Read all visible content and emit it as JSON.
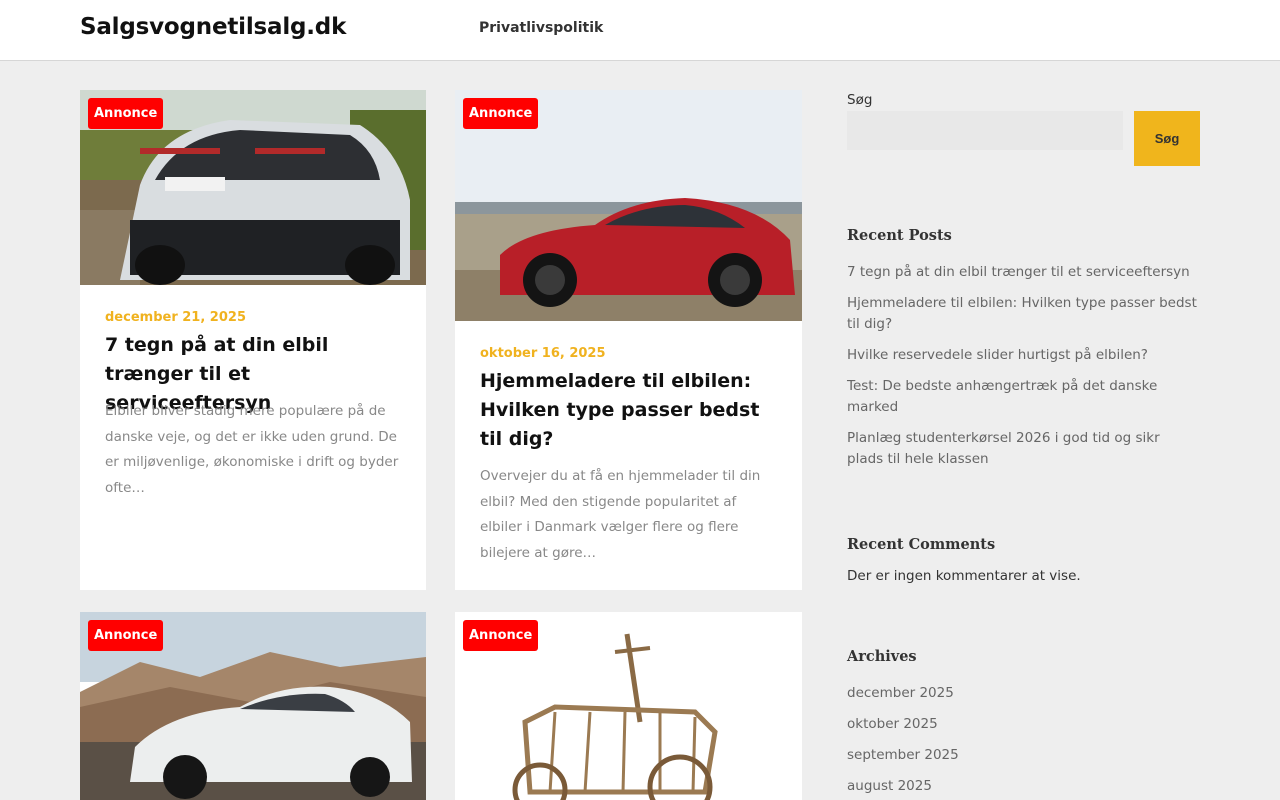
{
  "header": {
    "site_title": "Salgsvognetilsalg.dk",
    "nav": [
      "Privatlivspolitik"
    ]
  },
  "posts": [
    {
      "badge": "Annonce",
      "date": "december 21, 2025",
      "title": "7 tegn på at din elbil trænger til et serviceeftersyn",
      "excerpt": "Elbiler bliver stadig mere populære på de danske veje, og det er ikke uden grund. De er miljøvenlige, økonomiske i drift og byder ofte…"
    },
    {
      "badge": "Annonce",
      "date": "oktober 16, 2025",
      "title": "Hjemmeladere til elbilen: Hvilken type passer bedst til dig?",
      "excerpt": "Overvejer du at få en hjemmelader til din elbil? Med den stigende popularitet af elbiler i Danmark vælger flere og flere bilejere at gøre…"
    },
    {
      "badge": "Annonce"
    },
    {
      "badge": "Annonce"
    }
  ],
  "sidebar": {
    "search": {
      "label": "Søg",
      "button": "Søg",
      "value": ""
    },
    "recent_posts": {
      "title": "Recent Posts",
      "items": [
        "7 tegn på at din elbil trænger til et serviceeftersyn",
        "Hjemmeladere til elbilen: Hvilken type passer bedst til dig?",
        "Hvilke reservedele slider hurtigst på elbilen?",
        "Test: De bedste anhængertræk på det danske marked",
        "Planlæg studenterkørsel 2026 i god tid og sikr plads til hele klassen"
      ]
    },
    "recent_comments": {
      "title": "Recent Comments",
      "empty_text": "Der er ingen kommentarer at vise."
    },
    "archives": {
      "title": "Archives",
      "items": [
        "december 2025",
        "oktober 2025",
        "september 2025",
        "august 2025"
      ]
    }
  },
  "colors": {
    "accent": "#f0b21f",
    "badge": "#ff0000",
    "background": "#eeeeee"
  }
}
